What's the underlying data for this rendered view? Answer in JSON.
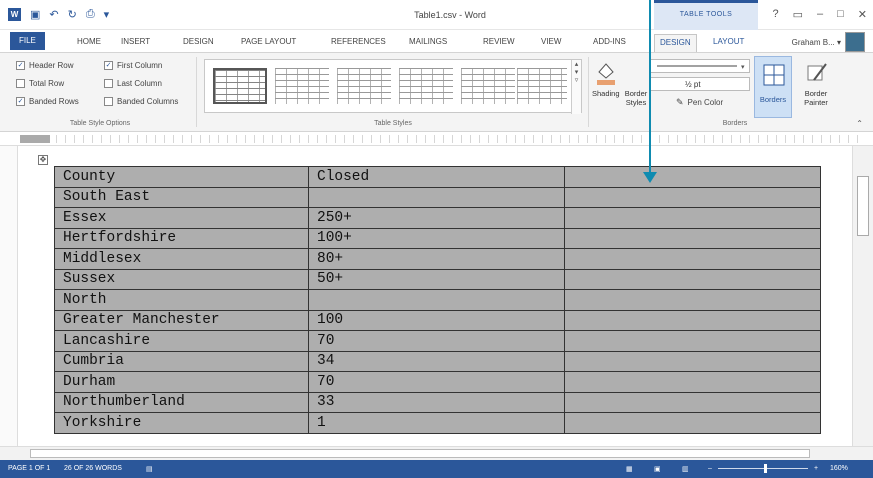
{
  "titlebar": {
    "title": "Table1.csv - Word",
    "context_group": "TABLE TOOLS",
    "help": "?",
    "restore": "▭",
    "minimize": "–",
    "maximize": "□",
    "close": "✕"
  },
  "tabs": [
    {
      "label": "FILE"
    },
    {
      "label": "HOME"
    },
    {
      "label": "INSERT"
    },
    {
      "label": "DESIGN"
    },
    {
      "label": "PAGE LAYOUT"
    },
    {
      "label": "REFERENCES"
    },
    {
      "label": "MAILINGS"
    },
    {
      "label": "REVIEW"
    },
    {
      "label": "VIEW"
    },
    {
      "label": "ADD-INS"
    },
    {
      "label": "DESIGN"
    },
    {
      "label": "LAYOUT"
    }
  ],
  "user": "Graham B... ▾",
  "style_options": {
    "items": [
      {
        "label": "Header Row",
        "checked": "✓"
      },
      {
        "label": "First Column",
        "checked": "✓"
      },
      {
        "label": "Total Row",
        "checked": ""
      },
      {
        "label": "Last Column",
        "checked": ""
      },
      {
        "label": "Banded Rows",
        "checked": "✓"
      },
      {
        "label": "Banded Columns",
        "checked": ""
      }
    ],
    "group_label": "Table Style Options"
  },
  "table_styles": {
    "group_label": "Table Styles"
  },
  "shading": {
    "label": "Shading"
  },
  "border_styles": {
    "label": "Border Styles"
  },
  "pen_weight": "½ pt",
  "pen_color": "Pen Color",
  "borders_btn": "Borders",
  "border_painter": "Border Painter",
  "borders_group_label": "Borders",
  "table": {
    "rows": [
      [
        "County",
        "Closed",
        ""
      ],
      [
        "South East",
        "",
        ""
      ],
      [
        "Essex",
        "250+",
        ""
      ],
      [
        "Hertfordshire",
        "100+",
        ""
      ],
      [
        "Middlesex",
        "80+",
        ""
      ],
      [
        "Sussex",
        "50+",
        ""
      ],
      [
        "North",
        "",
        ""
      ],
      [
        "Greater Manchester",
        "100",
        ""
      ],
      [
        "Lancashire",
        "70",
        ""
      ],
      [
        "Cumbria",
        "34",
        ""
      ],
      [
        "Durham",
        "70",
        ""
      ],
      [
        "Northumberland",
        "33",
        ""
      ],
      [
        "Yorkshire",
        "1",
        ""
      ]
    ]
  },
  "status": {
    "page": "PAGE 1 OF 1",
    "words": "26 OF 26 WORDS",
    "zoom": "160%"
  },
  "colors": {
    "accent": "#2b579a",
    "arrow": "#0f8bb0",
    "cell_fill": "#aeaeae"
  }
}
